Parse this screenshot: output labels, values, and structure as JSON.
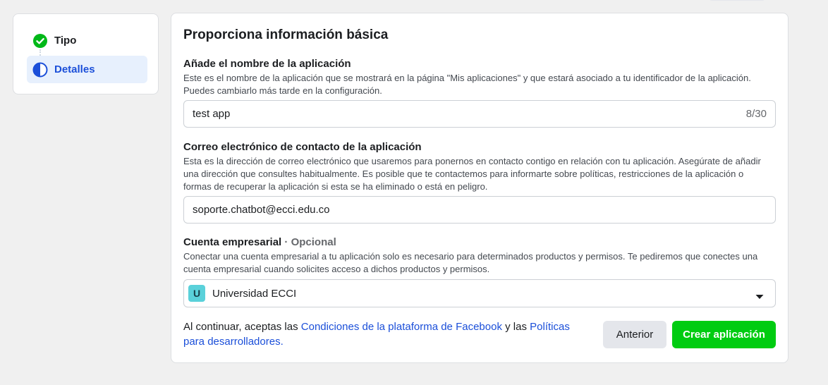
{
  "steps": [
    {
      "label": "Tipo",
      "status": "done",
      "icon": "check-circle-icon"
    },
    {
      "label": "Detalles",
      "status": "active",
      "icon": "half-circle-icon"
    }
  ],
  "main": {
    "title": "Proporciona información básica",
    "app_name": {
      "label": "Añade el nombre de la aplicación",
      "description_line1": "Este es el nombre de la aplicación que se mostrará en la página \"Mis aplicaciones\" y que estará asociado a tu identificador de la aplicación.",
      "description_line2": "Puedes cambiarlo más tarde en la configuración.",
      "value": "test app",
      "counter": "8/30"
    },
    "email": {
      "label": "Correo electrónico de contacto de la aplicación",
      "description_line1": "Esta es la dirección de correo electrónico que usaremos para ponernos en contacto contigo en relación con tu aplicación. Asegúrate de añadir",
      "description_line2": "una dirección que consultes habitualmente. Es posible que te contactemos para informarte sobre políticas, restricciones de la aplicación o",
      "description_line3": "formas de recuperar la aplicación si esta se ha eliminado o está en peligro.",
      "value": "soporte.chatbot@ecci.edu.co"
    },
    "business": {
      "label": "Cuenta empresarial",
      "optional": "· Opcional",
      "description_line1": "Conectar una cuenta empresarial a tu aplicación solo es necesario para determinados productos y permisos. Te pediremos que conectes una",
      "description_line2": "cuenta empresarial cuando solicites acceso a dichos productos y permisos.",
      "selected_badge": "U",
      "selected": "Universidad ECCI",
      "icon": "caret-down-icon"
    },
    "footer": {
      "text_before": "Al continuar, aceptas las ",
      "link1": "Condiciones de la plataforma de Facebook",
      "text_middle": " y las ",
      "link2_part1": "Políticas",
      "link2_part2": "para desarrolladores",
      "text_after": "."
    },
    "buttons": {
      "previous": "Anterior",
      "create": "Crear aplicación"
    }
  },
  "colors": {
    "background": "#f0f0f0",
    "accent_blue": "#1b4fd9",
    "success_green": "#00cc11",
    "active_step_bg": "#e7f0fd",
    "badge_cyan": "#5ad1da"
  }
}
